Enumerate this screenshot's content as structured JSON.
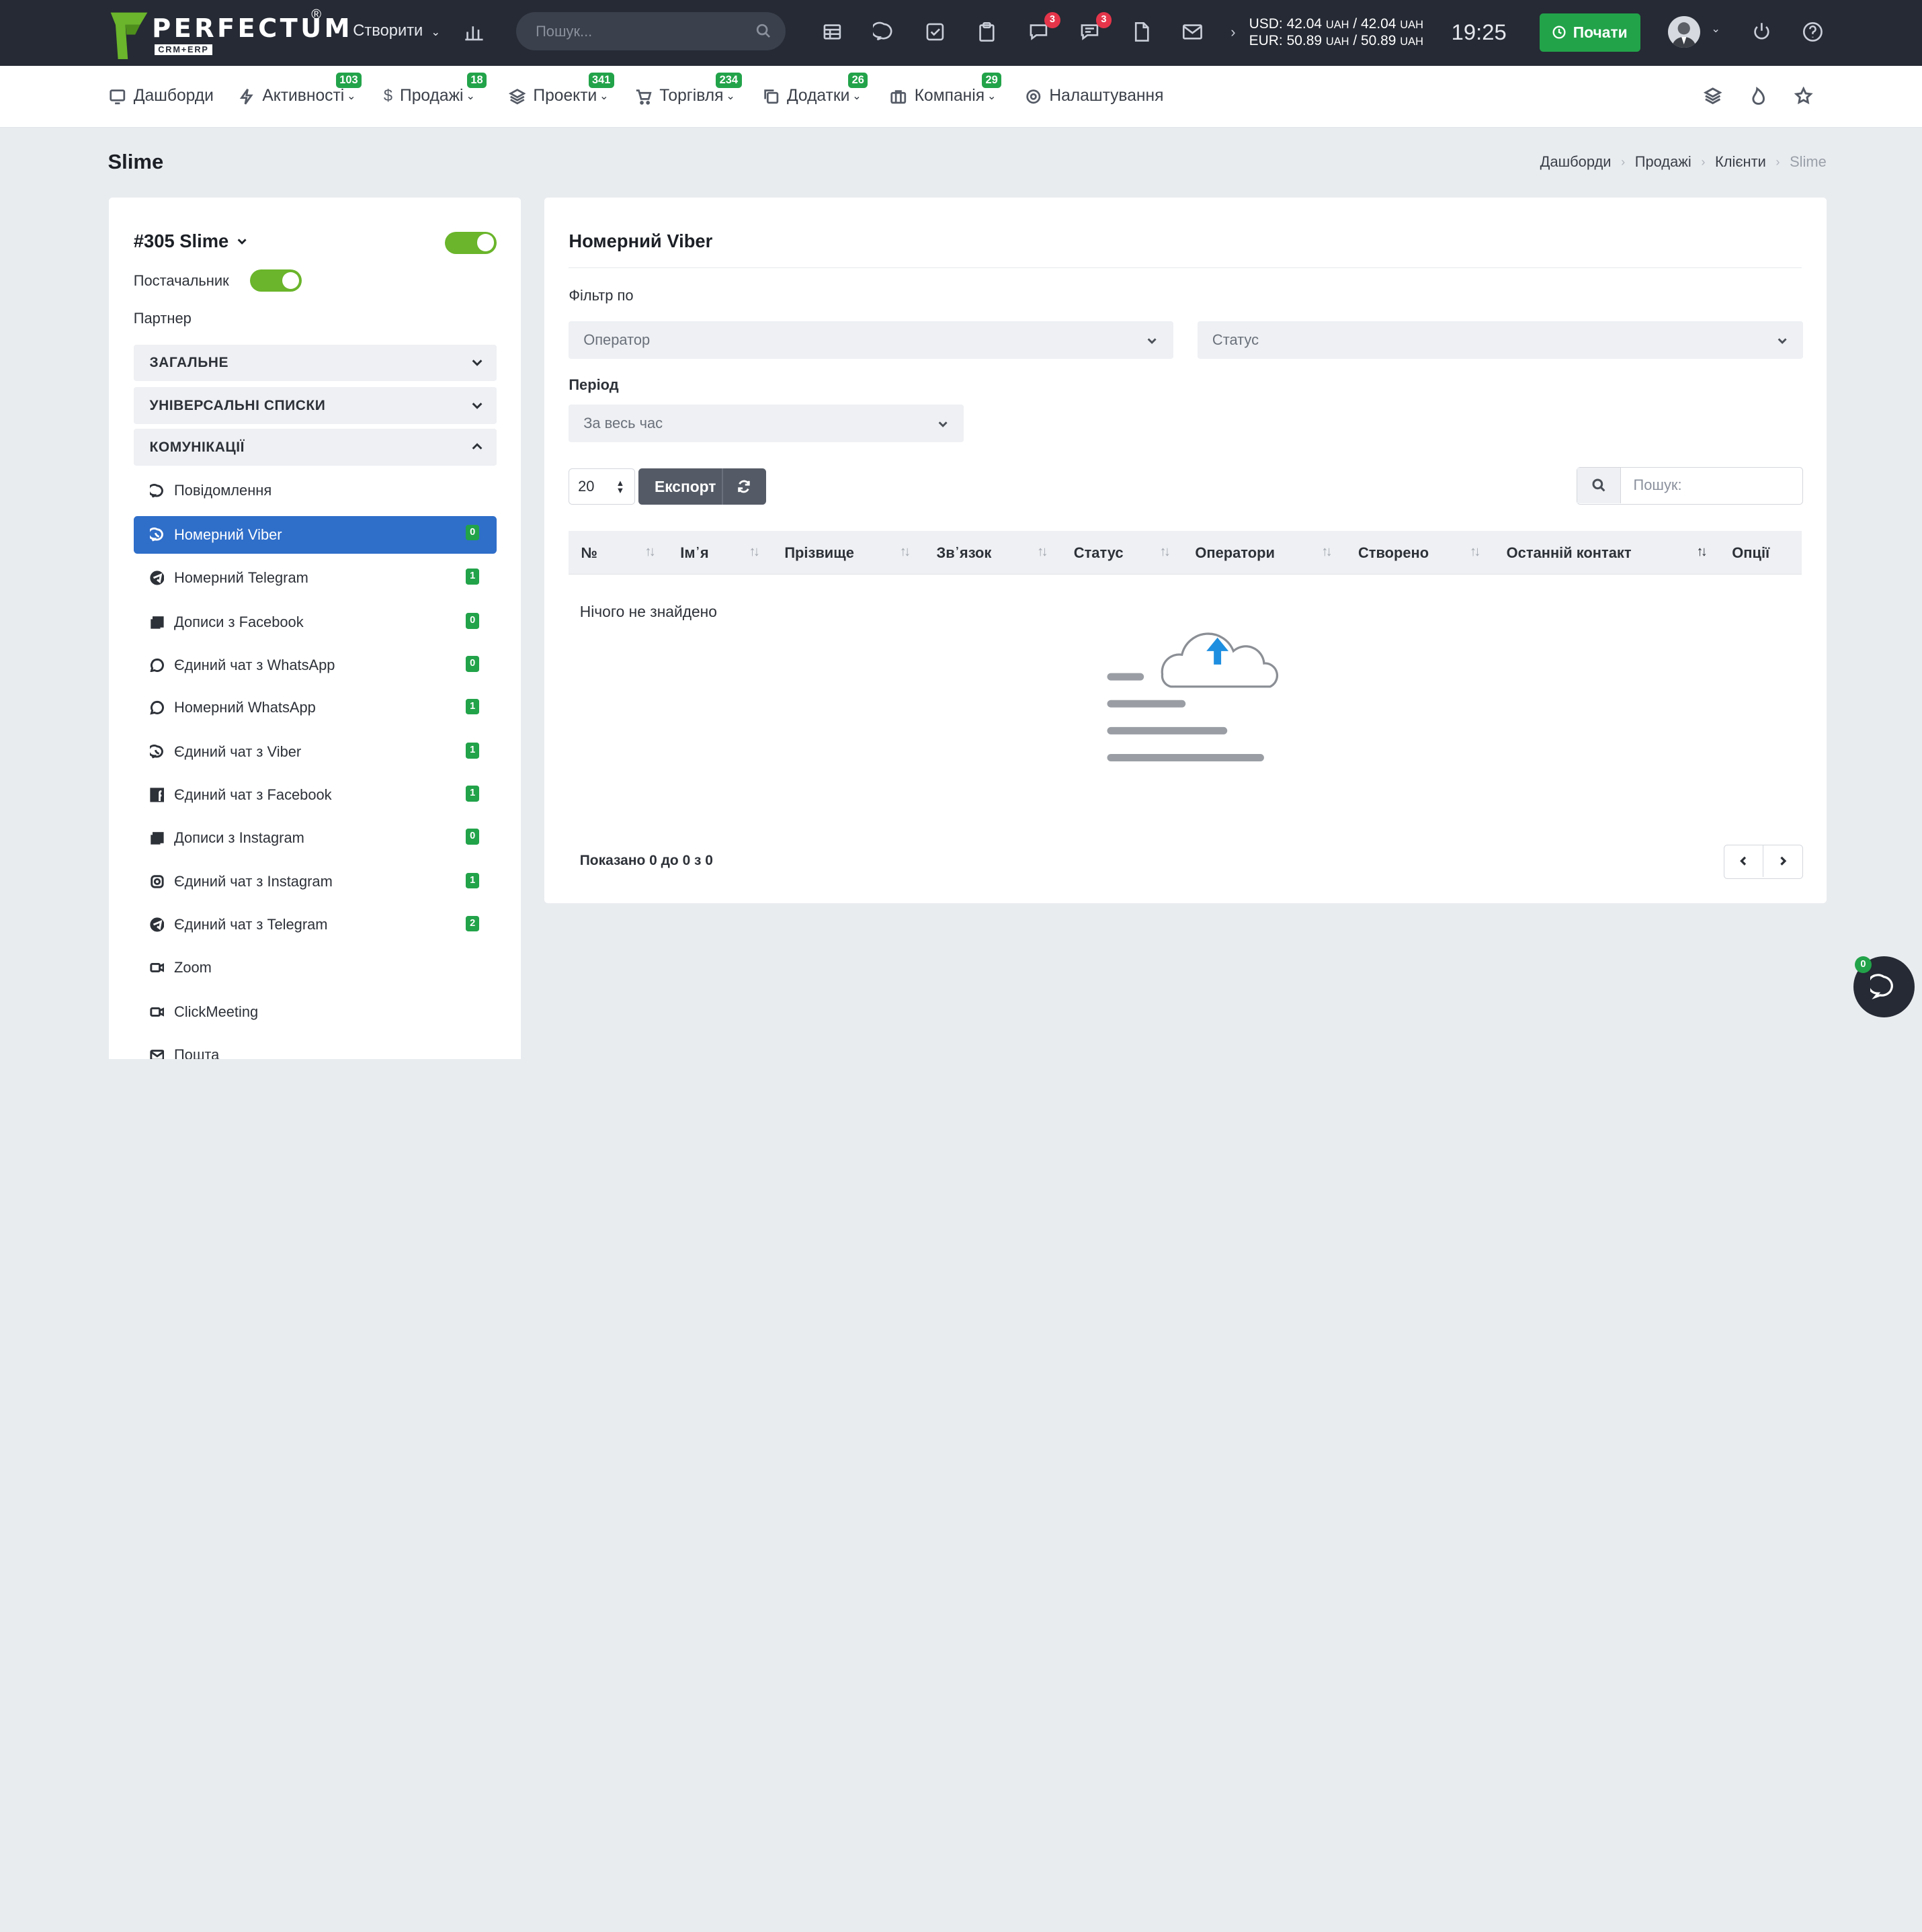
{
  "header": {
    "logo_text": "PERFECTUM",
    "logo_reg": "®",
    "logo_sub": "CRM+ERP",
    "create_label": "Створити",
    "search_placeholder": "Пошук...",
    "badge_chat": "3",
    "badge_messages": "3",
    "rate_usd": "USD: 42.04",
    "rate_usd_unit1": "UAH",
    "rate_usd_mid": "/ 42.04",
    "rate_usd_unit2": "UAH",
    "rate_eur": "EUR: 50.89",
    "rate_eur_unit1": "UAH",
    "rate_eur_mid": "/ 50.89",
    "rate_eur_unit2": "UAH",
    "time": "19:25",
    "start_label": "Почати"
  },
  "nav": {
    "items": [
      {
        "label": "Дашборди",
        "badge": ""
      },
      {
        "label": "Активності",
        "badge": "103"
      },
      {
        "label": "Продажі",
        "badge": "18"
      },
      {
        "label": "Проекти",
        "badge": "341"
      },
      {
        "label": "Торгівля",
        "badge": "234"
      },
      {
        "label": "Додатки",
        "badge": "26"
      },
      {
        "label": "Компанія",
        "badge": "29"
      },
      {
        "label": "Налаштування",
        "badge": ""
      }
    ]
  },
  "page": {
    "title": "Slime",
    "breadcrumb": [
      "Дашборди",
      "Продажі",
      "Клієнти",
      "Slime"
    ]
  },
  "sidebar": {
    "client_title": "#305 Slime",
    "supplier_label": "Постачальник",
    "partner_label": "Партнер",
    "sections": [
      "ЗАГАЛЬНЕ",
      "УНІВЕРСАЛЬНІ СПИСКИ",
      "КОМУНІКАЦІЇ"
    ],
    "comm_items": [
      {
        "label": "Повідомлення",
        "badge": "",
        "icon": "chat-bubble-icon"
      },
      {
        "label": "Номерний Viber",
        "badge": "0",
        "icon": "viber-icon"
      },
      {
        "label": "Номерний Telegram",
        "badge": "1",
        "icon": "telegram-icon"
      },
      {
        "label": "Дописи з Facebook",
        "badge": "0",
        "icon": "posts-icon"
      },
      {
        "label": "Єдиний чат з WhatsApp",
        "badge": "0",
        "icon": "whatsapp-icon"
      },
      {
        "label": "Номерний WhatsApp",
        "badge": "1",
        "icon": "whatsapp-icon"
      },
      {
        "label": "Єдиний чат з Viber",
        "badge": "1",
        "icon": "viber-icon"
      },
      {
        "label": "Єдиний чат з Facebook",
        "badge": "1",
        "icon": "facebook-icon"
      },
      {
        "label": "Дописи з Instagram",
        "badge": "0",
        "icon": "posts-icon"
      },
      {
        "label": "Єдиний чат з Instagram",
        "badge": "1",
        "icon": "instagram-icon"
      },
      {
        "label": "Єдиний чат з Telegram",
        "badge": "2",
        "icon": "telegram-icon"
      },
      {
        "label": "Zoom",
        "badge": "",
        "icon": "video-icon"
      },
      {
        "label": "ClickMeeting",
        "badge": "",
        "icon": "video-icon"
      },
      {
        "label": "Пошта",
        "badge": "",
        "icon": "mail-icon"
      }
    ]
  },
  "main": {
    "title": "Номерний Viber",
    "filter_label": "Фільтр по",
    "operator_placeholder": "Оператор",
    "status_placeholder": "Статус",
    "period_label": "Період",
    "period_value": "За весь час",
    "page_length": "20",
    "export_label": "Експорт",
    "search_placeholder": "Пошук:",
    "columns": [
      "№",
      "Ім᾽я",
      "Прізвище",
      "Зв᾽язок",
      "Статус",
      "Оператори",
      "Створено",
      "Останній контакт",
      "Опції"
    ],
    "empty_text": "Нічого не знайдено",
    "shown_text": "Показано 0 до 0 з 0"
  },
  "chat_widget": {
    "badge": "0"
  },
  "colors": {
    "topbar": "#252a34",
    "accent_green": "#22a34a",
    "active_blue": "#2f6ec9",
    "badge_red": "#e5354a"
  }
}
